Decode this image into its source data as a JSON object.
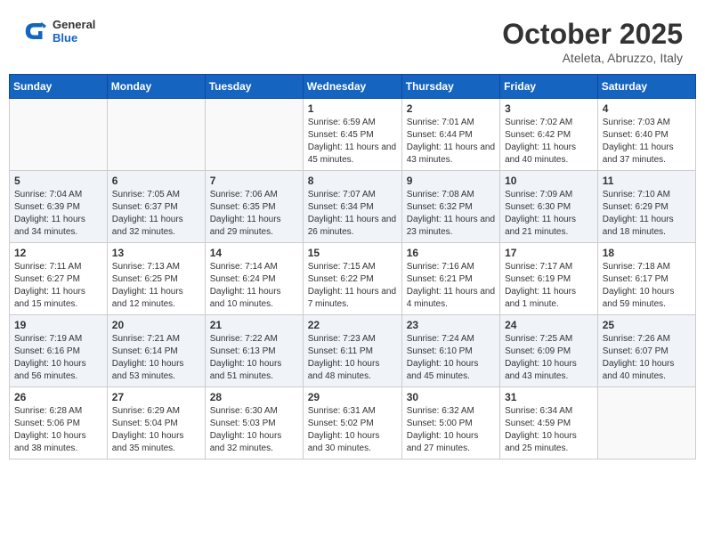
{
  "header": {
    "logo_general": "General",
    "logo_blue": "Blue",
    "month": "October 2025",
    "location": "Ateleta, Abruzzo, Italy"
  },
  "weekdays": [
    "Sunday",
    "Monday",
    "Tuesday",
    "Wednesday",
    "Thursday",
    "Friday",
    "Saturday"
  ],
  "weeks": [
    [
      {
        "day": "",
        "info": ""
      },
      {
        "day": "",
        "info": ""
      },
      {
        "day": "",
        "info": ""
      },
      {
        "day": "1",
        "info": "Sunrise: 6:59 AM\nSunset: 6:45 PM\nDaylight: 11 hours and 45 minutes."
      },
      {
        "day": "2",
        "info": "Sunrise: 7:01 AM\nSunset: 6:44 PM\nDaylight: 11 hours and 43 minutes."
      },
      {
        "day": "3",
        "info": "Sunrise: 7:02 AM\nSunset: 6:42 PM\nDaylight: 11 hours and 40 minutes."
      },
      {
        "day": "4",
        "info": "Sunrise: 7:03 AM\nSunset: 6:40 PM\nDaylight: 11 hours and 37 minutes."
      }
    ],
    [
      {
        "day": "5",
        "info": "Sunrise: 7:04 AM\nSunset: 6:39 PM\nDaylight: 11 hours and 34 minutes."
      },
      {
        "day": "6",
        "info": "Sunrise: 7:05 AM\nSunset: 6:37 PM\nDaylight: 11 hours and 32 minutes."
      },
      {
        "day": "7",
        "info": "Sunrise: 7:06 AM\nSunset: 6:35 PM\nDaylight: 11 hours and 29 minutes."
      },
      {
        "day": "8",
        "info": "Sunrise: 7:07 AM\nSunset: 6:34 PM\nDaylight: 11 hours and 26 minutes."
      },
      {
        "day": "9",
        "info": "Sunrise: 7:08 AM\nSunset: 6:32 PM\nDaylight: 11 hours and 23 minutes."
      },
      {
        "day": "10",
        "info": "Sunrise: 7:09 AM\nSunset: 6:30 PM\nDaylight: 11 hours and 21 minutes."
      },
      {
        "day": "11",
        "info": "Sunrise: 7:10 AM\nSunset: 6:29 PM\nDaylight: 11 hours and 18 minutes."
      }
    ],
    [
      {
        "day": "12",
        "info": "Sunrise: 7:11 AM\nSunset: 6:27 PM\nDaylight: 11 hours and 15 minutes."
      },
      {
        "day": "13",
        "info": "Sunrise: 7:13 AM\nSunset: 6:25 PM\nDaylight: 11 hours and 12 minutes."
      },
      {
        "day": "14",
        "info": "Sunrise: 7:14 AM\nSunset: 6:24 PM\nDaylight: 11 hours and 10 minutes."
      },
      {
        "day": "15",
        "info": "Sunrise: 7:15 AM\nSunset: 6:22 PM\nDaylight: 11 hours and 7 minutes."
      },
      {
        "day": "16",
        "info": "Sunrise: 7:16 AM\nSunset: 6:21 PM\nDaylight: 11 hours and 4 minutes."
      },
      {
        "day": "17",
        "info": "Sunrise: 7:17 AM\nSunset: 6:19 PM\nDaylight: 11 hours and 1 minute."
      },
      {
        "day": "18",
        "info": "Sunrise: 7:18 AM\nSunset: 6:17 PM\nDaylight: 10 hours and 59 minutes."
      }
    ],
    [
      {
        "day": "19",
        "info": "Sunrise: 7:19 AM\nSunset: 6:16 PM\nDaylight: 10 hours and 56 minutes."
      },
      {
        "day": "20",
        "info": "Sunrise: 7:21 AM\nSunset: 6:14 PM\nDaylight: 10 hours and 53 minutes."
      },
      {
        "day": "21",
        "info": "Sunrise: 7:22 AM\nSunset: 6:13 PM\nDaylight: 10 hours and 51 minutes."
      },
      {
        "day": "22",
        "info": "Sunrise: 7:23 AM\nSunset: 6:11 PM\nDaylight: 10 hours and 48 minutes."
      },
      {
        "day": "23",
        "info": "Sunrise: 7:24 AM\nSunset: 6:10 PM\nDaylight: 10 hours and 45 minutes."
      },
      {
        "day": "24",
        "info": "Sunrise: 7:25 AM\nSunset: 6:09 PM\nDaylight: 10 hours and 43 minutes."
      },
      {
        "day": "25",
        "info": "Sunrise: 7:26 AM\nSunset: 6:07 PM\nDaylight: 10 hours and 40 minutes."
      }
    ],
    [
      {
        "day": "26",
        "info": "Sunrise: 6:28 AM\nSunset: 5:06 PM\nDaylight: 10 hours and 38 minutes."
      },
      {
        "day": "27",
        "info": "Sunrise: 6:29 AM\nSunset: 5:04 PM\nDaylight: 10 hours and 35 minutes."
      },
      {
        "day": "28",
        "info": "Sunrise: 6:30 AM\nSunset: 5:03 PM\nDaylight: 10 hours and 32 minutes."
      },
      {
        "day": "29",
        "info": "Sunrise: 6:31 AM\nSunset: 5:02 PM\nDaylight: 10 hours and 30 minutes."
      },
      {
        "day": "30",
        "info": "Sunrise: 6:32 AM\nSunset: 5:00 PM\nDaylight: 10 hours and 27 minutes."
      },
      {
        "day": "31",
        "info": "Sunrise: 6:34 AM\nSunset: 4:59 PM\nDaylight: 10 hours and 25 minutes."
      },
      {
        "day": "",
        "info": ""
      }
    ]
  ]
}
